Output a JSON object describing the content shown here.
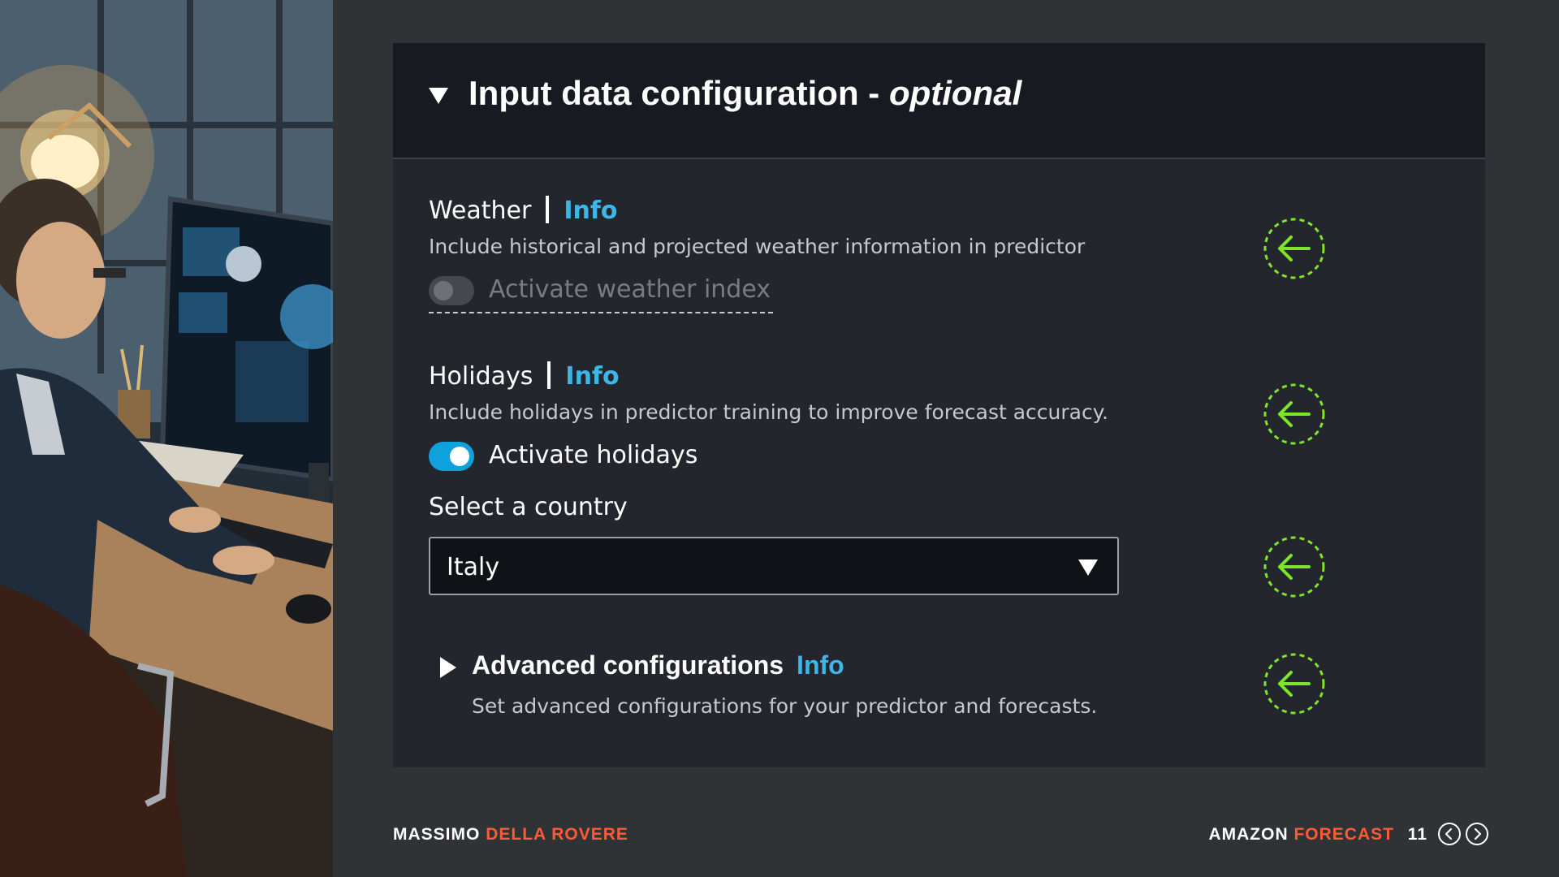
{
  "panel": {
    "title_main": "Input data configuration - ",
    "title_optional": "optional"
  },
  "weather": {
    "label": "Weather",
    "info": "Info",
    "description": "Include historical and projected weather information in predictor",
    "toggle_label": "Activate weather index",
    "toggle_state": "off",
    "toggle_disabled": true
  },
  "holidays": {
    "label": "Holidays",
    "info": "Info",
    "description": "Include holidays in predictor training to improve forecast accuracy.",
    "toggle_label": "Activate holidays",
    "toggle_state": "on"
  },
  "country_select": {
    "label": "Select a country",
    "value": "Italy"
  },
  "advanced": {
    "title": "Advanced configurations",
    "info": "Info",
    "description": "Set advanced configurations for your predictor and forecasts."
  },
  "footer": {
    "author_first": "MASSIMO",
    "author_last": "DELLA ROVERE",
    "product_first": "AMAZON",
    "product_second": "FORECAST",
    "page_number": "11"
  },
  "colors": {
    "accent_info": "#3fb6e8",
    "toggle_on": "#0ea1dc",
    "marker_green": "#7ee629",
    "footer_orange": "#ff5a36"
  },
  "icons": {
    "collapse": "caret-down-icon",
    "expand": "caret-right-icon",
    "marker": "arrow-left-dashed-circle-icon",
    "prev": "chevron-left-circle-icon",
    "next": "chevron-right-circle-icon"
  }
}
